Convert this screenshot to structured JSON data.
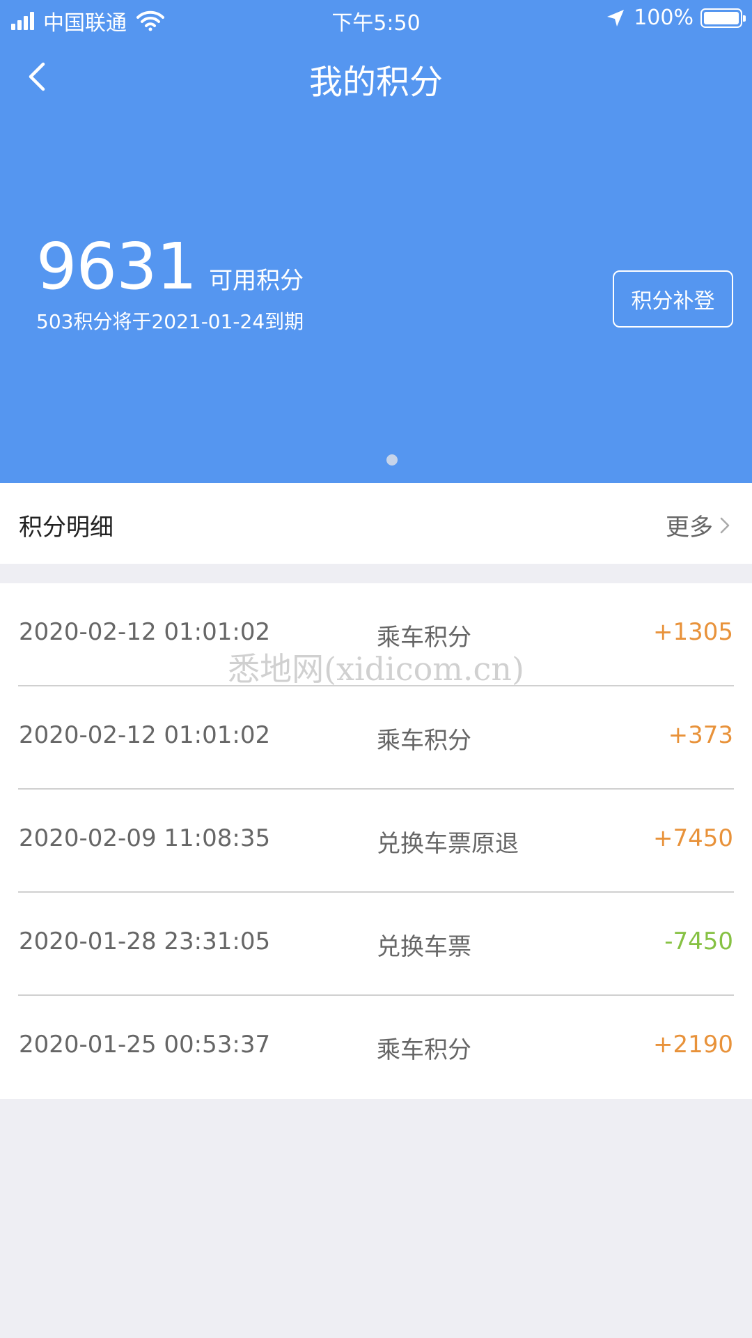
{
  "status_bar": {
    "carrier": "中国联通",
    "time": "下午5:50",
    "battery": "100%",
    "icons": [
      "signal-icon",
      "wifi-icon",
      "location-arrow-icon",
      "battery-icon"
    ]
  },
  "nav": {
    "title": "我的积分",
    "back_icon": "chevron-left-icon"
  },
  "summary": {
    "points": "9631",
    "points_label": "可用积分",
    "expire_note": "503积分将于2021-01-24到期",
    "supplement_button": "积分补登"
  },
  "details": {
    "title": "积分明细",
    "more_label": "更多",
    "more_icon": "chevron-right-icon"
  },
  "records": [
    {
      "time": "2020-02-12 01:01:02",
      "desc": "乘车积分",
      "amount": "+1305"
    },
    {
      "time": "2020-02-12 01:01:02",
      "desc": "乘车积分",
      "amount": "+373"
    },
    {
      "time": "2020-02-09 11:08:35",
      "desc": "兑换车票原退",
      "amount": "+7450"
    },
    {
      "time": "2020-01-28 23:31:05",
      "desc": "兑换车票",
      "amount": "-7450"
    },
    {
      "time": "2020-01-25 00:53:37",
      "desc": "乘车积分",
      "amount": "+2190"
    }
  ],
  "watermark": "悉地网(xidicom.cn)",
  "colors": {
    "header_blue": "#5596f0",
    "positive": "#e8923a",
    "negative": "#86c143",
    "background": "#eeeef3"
  }
}
